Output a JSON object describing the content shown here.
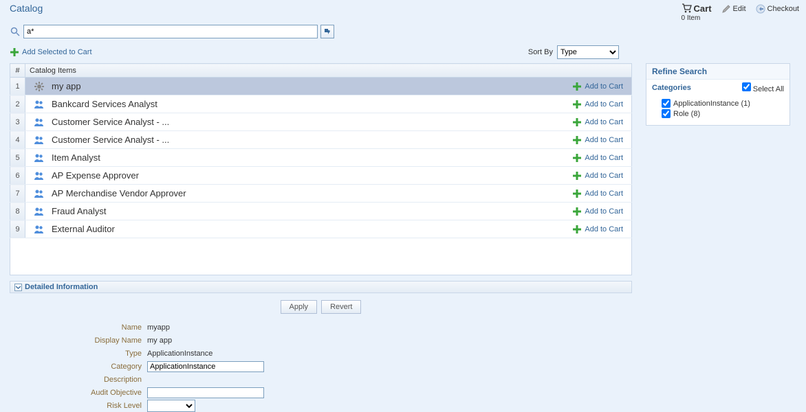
{
  "header": {
    "title": "Catalog",
    "cart_label": "Cart",
    "cart_items": "0 Item",
    "edit_label": "Edit",
    "checkout_label": "Checkout"
  },
  "search": {
    "value": "a*"
  },
  "toolbar": {
    "add_selected": "Add Selected to Cart",
    "sort_by_label": "Sort By",
    "sort_by_value": "Type"
  },
  "table": {
    "col_num": "#",
    "col_items": "Catalog Items",
    "add_to_cart": "Add to Cart",
    "rows": [
      {
        "n": "1",
        "type": "app",
        "label": "my app",
        "selected": true
      },
      {
        "n": "2",
        "type": "role",
        "label": "Bankcard Services Analyst"
      },
      {
        "n": "3",
        "type": "role",
        "label": "Customer Service Analyst - ..."
      },
      {
        "n": "4",
        "type": "role",
        "label": "Customer Service Analyst - ..."
      },
      {
        "n": "5",
        "type": "role",
        "label": "Item Analyst"
      },
      {
        "n": "6",
        "type": "role",
        "label": "AP Expense Approver"
      },
      {
        "n": "7",
        "type": "role",
        "label": "AP Merchandise Vendor Approver"
      },
      {
        "n": "8",
        "type": "role",
        "label": "Fraud Analyst"
      },
      {
        "n": "9",
        "type": "role",
        "label": "External Auditor"
      }
    ]
  },
  "refine": {
    "title": "Refine Search",
    "categories_label": "Categories",
    "select_all": "Select All",
    "items": [
      {
        "label": "ApplicationInstance (1)",
        "checked": true
      },
      {
        "label": "Role (8)",
        "checked": true
      }
    ]
  },
  "detail": {
    "header": "Detailed Information",
    "apply": "Apply",
    "revert": "Revert",
    "fields": {
      "name_label": "Name",
      "name_value": "myapp",
      "display_name_label": "Display Name",
      "display_name_value": "my app",
      "type_label": "Type",
      "type_value": "ApplicationInstance",
      "category_label": "Category",
      "category_value": "ApplicationInstance",
      "description_label": "Description",
      "audit_label": "Audit Objective",
      "audit_value": "",
      "risk_label": "Risk Level"
    }
  }
}
